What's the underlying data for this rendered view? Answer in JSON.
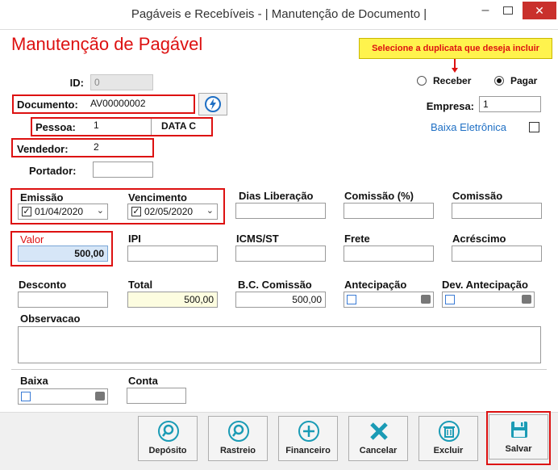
{
  "window": {
    "title": "Pagáveis e Recebíveis - | Manutenção de Documento |",
    "close_glyph": "✕",
    "min_glyph": "–"
  },
  "form": {
    "heading": "Manutenção de Pagável",
    "tooltip": "Selecione a duplicata que deseja incluir",
    "id": {
      "label": "ID:",
      "value": "0"
    },
    "documento": {
      "label": "Documento:",
      "value": "AV00000002"
    },
    "pessoa": {
      "label": "Pessoa:",
      "code": "1",
      "name": "DATA C"
    },
    "vendedor": {
      "label": "Vendedor:",
      "value": "2"
    },
    "portador": {
      "label": "Portador:",
      "value": ""
    },
    "tipo": {
      "receber": "Receber",
      "pagar": "Pagar",
      "selected": "Pagar"
    },
    "empresa": {
      "label": "Empresa:",
      "value": "1"
    },
    "baixa_eletronica": {
      "label": "Baixa Eletrônica",
      "checked": false
    },
    "emissao": {
      "label": "Emissão",
      "value": "01/04/2020",
      "checked": true
    },
    "vencimento": {
      "label": "Vencimento",
      "value": "02/05/2020",
      "checked": true
    },
    "dias_liberacao": {
      "label": "Dias Liberação",
      "value": ""
    },
    "comissao_pct": {
      "label": "Comissão (%)",
      "value": ""
    },
    "comissao": {
      "label": "Comissão",
      "value": ""
    },
    "valor": {
      "label": "Valor",
      "value": "500,00"
    },
    "ipi": {
      "label": "IPI",
      "value": ""
    },
    "icms_st": {
      "label": "ICMS/ST",
      "value": ""
    },
    "frete": {
      "label": "Frete",
      "value": ""
    },
    "acrescimo": {
      "label": "Acréscimo",
      "value": ""
    },
    "desconto": {
      "label": "Desconto",
      "value": ""
    },
    "total": {
      "label": "Total",
      "value": "500,00"
    },
    "bc_comissao": {
      "label": "B.C. Comissão",
      "value": "500,00"
    },
    "antecipacao": {
      "label": "Antecipação"
    },
    "dev_antecipacao": {
      "label": "Dev. Antecipação"
    },
    "observacao": {
      "label": "Observacao",
      "value": ""
    },
    "baixa": {
      "label": "Baixa"
    },
    "conta": {
      "label": "Conta",
      "value": ""
    }
  },
  "buttons": {
    "deposito": "Depósito",
    "rastreio": "Rastreio",
    "financeiro": "Financeiro",
    "cancelar": "Cancelar",
    "excluir": "Excluir",
    "salvar": "Salvar"
  },
  "colors": {
    "accent_red": "#d11111",
    "tooltip_bg": "#fff34d",
    "button_teal": "#1a9bb5",
    "close_red": "#c9302c",
    "link_blue": "#1e6fc4"
  },
  "icons": {
    "deposito": "magnifier-teal-icon",
    "rastreio": "magnifier-teal-icon",
    "financeiro": "plus-circle-icon",
    "cancelar": "x-cross-icon",
    "excluir": "trash-circle-icon",
    "salvar": "floppy-disk-icon",
    "lookup": "lightning-icon"
  }
}
